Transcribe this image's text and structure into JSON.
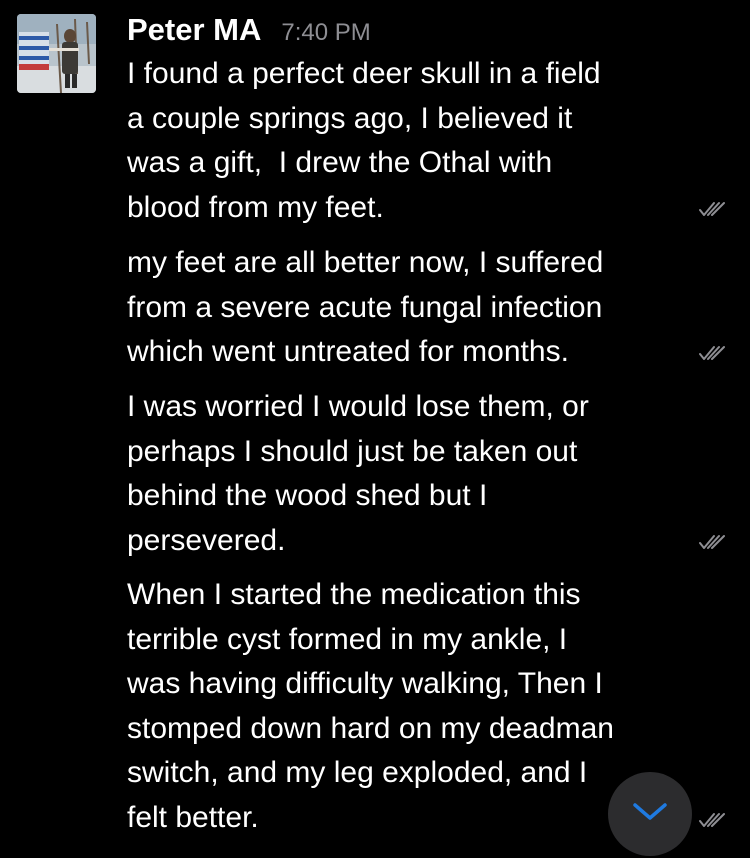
{
  "message_group": {
    "sender_name": "Peter MA",
    "timestamp": "7:40 PM",
    "avatar": "profile-photo"
  },
  "messages": [
    {
      "lines": [
        "I found a perfect deer skull in a field",
        "a couple springs ago, I believed it",
        "was a gift,  I drew the Othal with",
        "blood from my feet."
      ],
      "status_icon": "double-check-icon"
    },
    {
      "lines": [
        "my feet are all better now, I suffered",
        "from a severe acute fungal infection",
        "which went untreated for months."
      ],
      "status_icon": "double-check-icon"
    },
    {
      "lines": [
        "I was worried I would lose them, or",
        "perhaps I should just be taken out",
        "behind the wood shed but I",
        "persevered."
      ],
      "status_icon": "double-check-icon"
    },
    {
      "lines": [
        "When I started the medication this",
        "terrible cyst formed in my ankle, I",
        "was having difficulty walking, Then I",
        "stomped down hard on my deadman",
        "switch, and my leg exploded, and I",
        "felt better."
      ],
      "status_icon": "double-check-icon"
    }
  ],
  "scroll_to_bottom": {
    "icon": "chevron-down-icon",
    "icon_color": "#1f7ae0"
  },
  "colors": {
    "background": "#000000",
    "text": "#ffffff",
    "timestamp": "#8e8e93",
    "checkmarks": "#8e8e93"
  }
}
